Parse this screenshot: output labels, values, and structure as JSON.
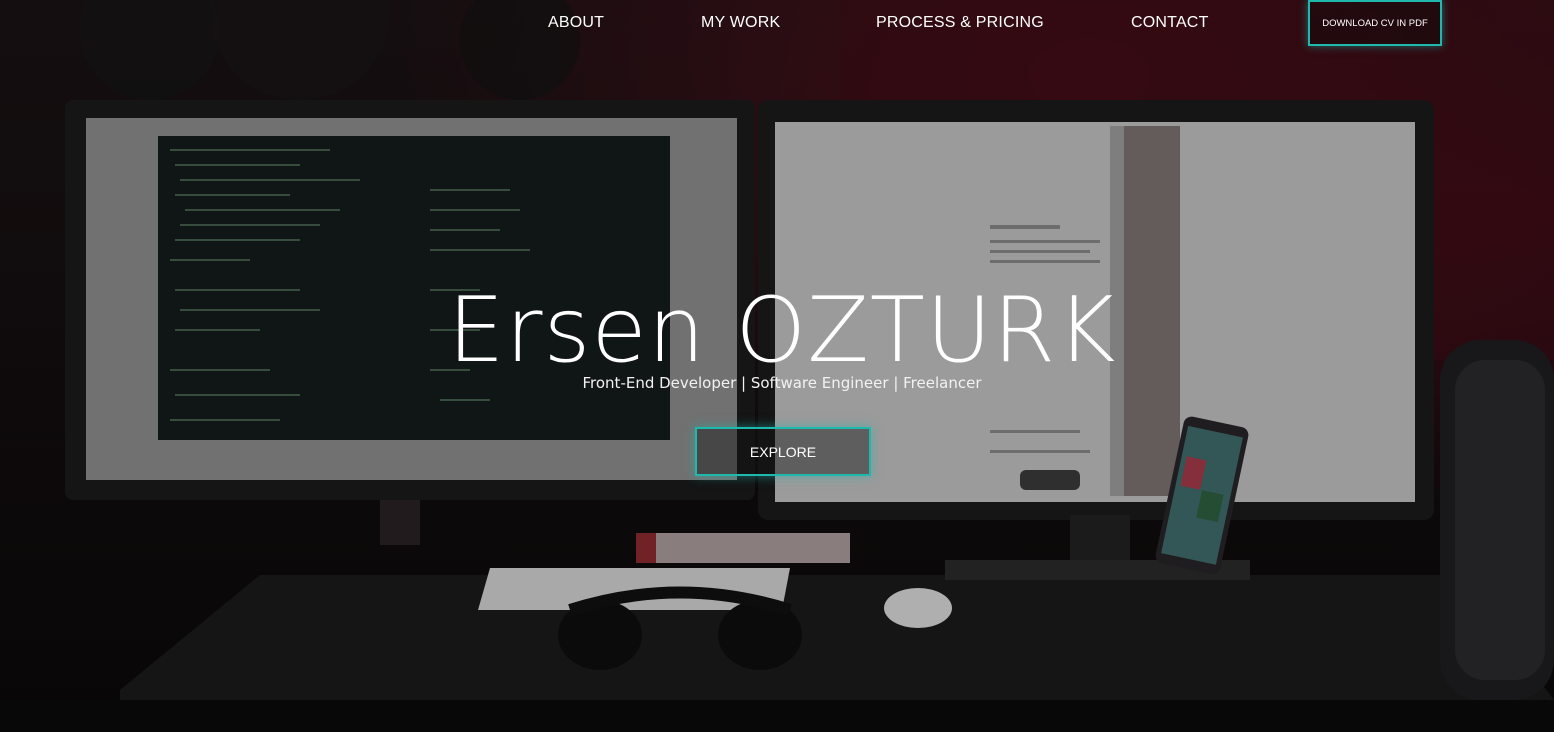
{
  "nav": {
    "about": "ABOUT",
    "my_work": "MY WORK",
    "process_pricing": "PROCESS & PRICING",
    "contact": "CONTACT",
    "download_cv": "DOWNLOAD CV IN PDF"
  },
  "hero": {
    "title": "Ersen OZTURK",
    "subtitle": "Front-End Developer | Software Engineer | Freelancer",
    "explore_label": "EXPLORE",
    "background_image": "desk-workstation-photo"
  },
  "colors": {
    "accent": "#1fb8ad",
    "text": "#ffffff",
    "background": "#120d0f"
  }
}
